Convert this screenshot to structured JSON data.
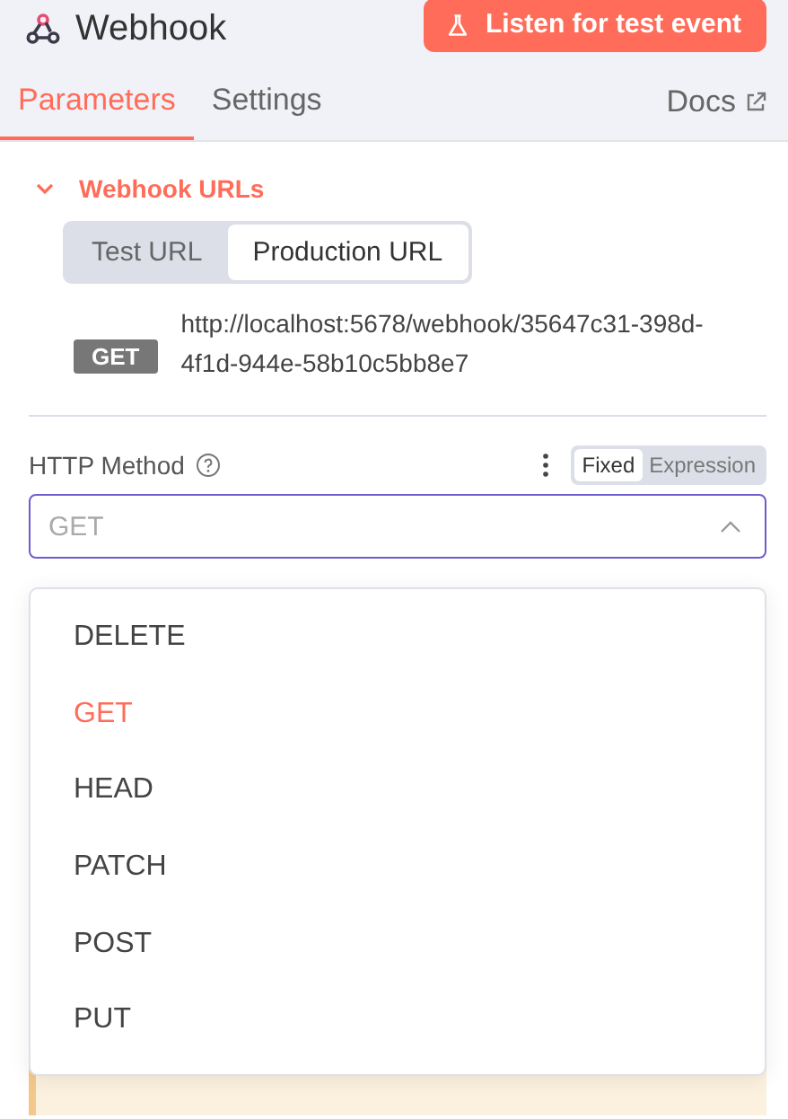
{
  "header": {
    "title": "Webhook",
    "action_button": "Listen for test event"
  },
  "tabs": [
    {
      "label": "Parameters",
      "selected": true
    },
    {
      "label": "Settings",
      "selected": false
    }
  ],
  "docs_link": "Docs",
  "section": {
    "title": "Webhook URLs",
    "expanded": true
  },
  "url_toggle": [
    {
      "label": "Test URL",
      "selected": false
    },
    {
      "label": "Production URL",
      "selected": true
    }
  ],
  "url": {
    "method": "GET",
    "address": "http://localhost:5678/webhook/35647c31-398d-4f1d-944e-58b10c5bb8e7"
  },
  "field": {
    "label": "HTTP Method",
    "mode_toggle": [
      {
        "label": "Fixed",
        "selected": true
      },
      {
        "label": "Expression",
        "selected": false
      }
    ],
    "placeholder": "GET",
    "expanded": true
  },
  "dropdown": [
    {
      "label": "DELETE",
      "selected": false
    },
    {
      "label": "GET",
      "selected": true
    },
    {
      "label": "HEAD",
      "selected": false
    },
    {
      "label": "PATCH",
      "selected": false
    },
    {
      "label": "POST",
      "selected": false
    },
    {
      "label": "PUT",
      "selected": false
    }
  ],
  "notice": {
    "kind": "warning"
  }
}
